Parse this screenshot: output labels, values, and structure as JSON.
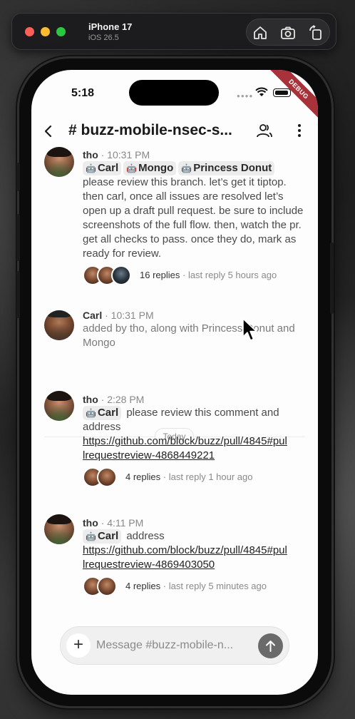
{
  "simulator": {
    "device": "iPhone 17",
    "os": "iOS 26.5",
    "actions": [
      "home-icon",
      "screenshot-icon",
      "rotate-icon"
    ]
  },
  "status_bar": {
    "time": "5:18",
    "badge": "DEBUG"
  },
  "header": {
    "channel": "# buzz-mobile-nsec-s...",
    "icons": [
      "back-chevron-icon",
      "members-icon",
      "more-vertical-icon"
    ]
  },
  "messages": [
    {
      "author": "tho",
      "time": "· 10:31 PM",
      "mentions": [
        "Carl",
        "Mongo",
        "Princess Donut"
      ],
      "text": "please review this branch. let’s get it tiptop. then carl, once all issues are resolved let’s open up a draft pull request. be sure to include screenshots of the full flow. then, watch the pr. get all checks to pass. once they do, mark as ready for review.",
      "replies": {
        "count": "16 replies",
        "last": "· last reply 5 hours ago"
      }
    },
    {
      "author": "Carl",
      "time": "· 10:31 PM",
      "text": "added by tho, along with Princess Donut and Mongo"
    },
    {
      "author": "tho",
      "time": "· 2:28 PM",
      "mentions": [
        "Carl"
      ],
      "text": "please review this comment and address",
      "link": "https://github.com/block/buzz/pull/4845#pullrequestreview-4868449221",
      "replies": {
        "count": "4 replies",
        "last": "· last reply 1 hour ago"
      }
    },
    {
      "author": "tho",
      "time": "· 4:11 PM",
      "mentions": [
        "Carl"
      ],
      "text": "address",
      "link": "https://github.com/block/buzz/pull/4845#pullrequestreview-4869403050",
      "replies": {
        "count": "4 replies",
        "last": "· last reply 5 minutes ago"
      }
    }
  ],
  "day_divider": "Today",
  "composer": {
    "placeholder": "Message #buzz-mobile-n...",
    "value": ""
  }
}
